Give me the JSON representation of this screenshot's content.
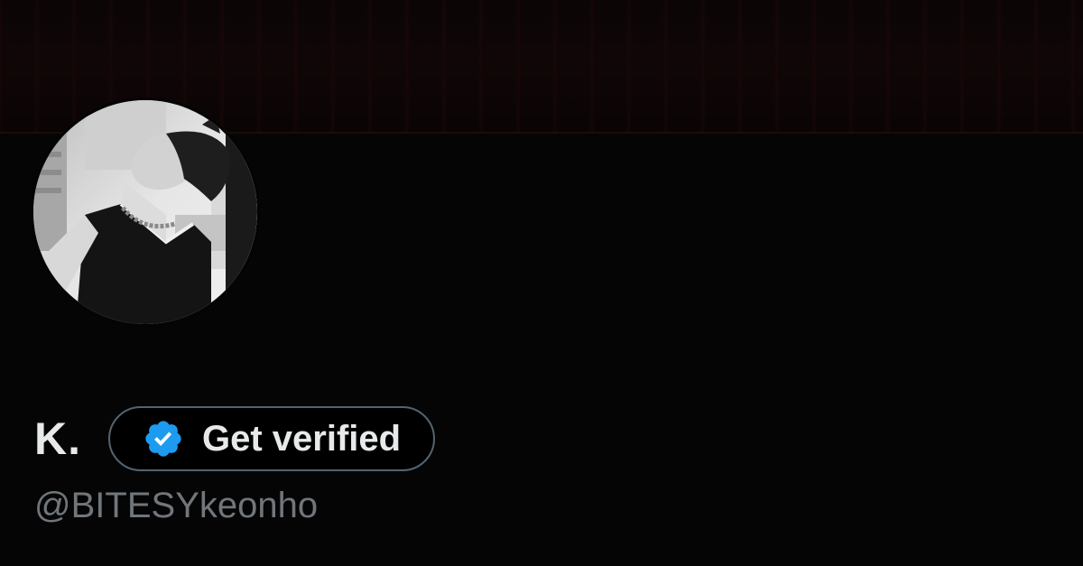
{
  "profile": {
    "display_name": "K.",
    "handle": "@BITESYkeonho",
    "verify_button_label": "Get verified",
    "avatar_description": "avatar",
    "colors": {
      "background": "#000000",
      "text_primary": "#e7e9ea",
      "text_secondary": "#71767b",
      "verified_badge": "#1d9bf0",
      "button_border": "#536471"
    },
    "icons": {
      "verify_button": "verified-badge-icon"
    }
  }
}
